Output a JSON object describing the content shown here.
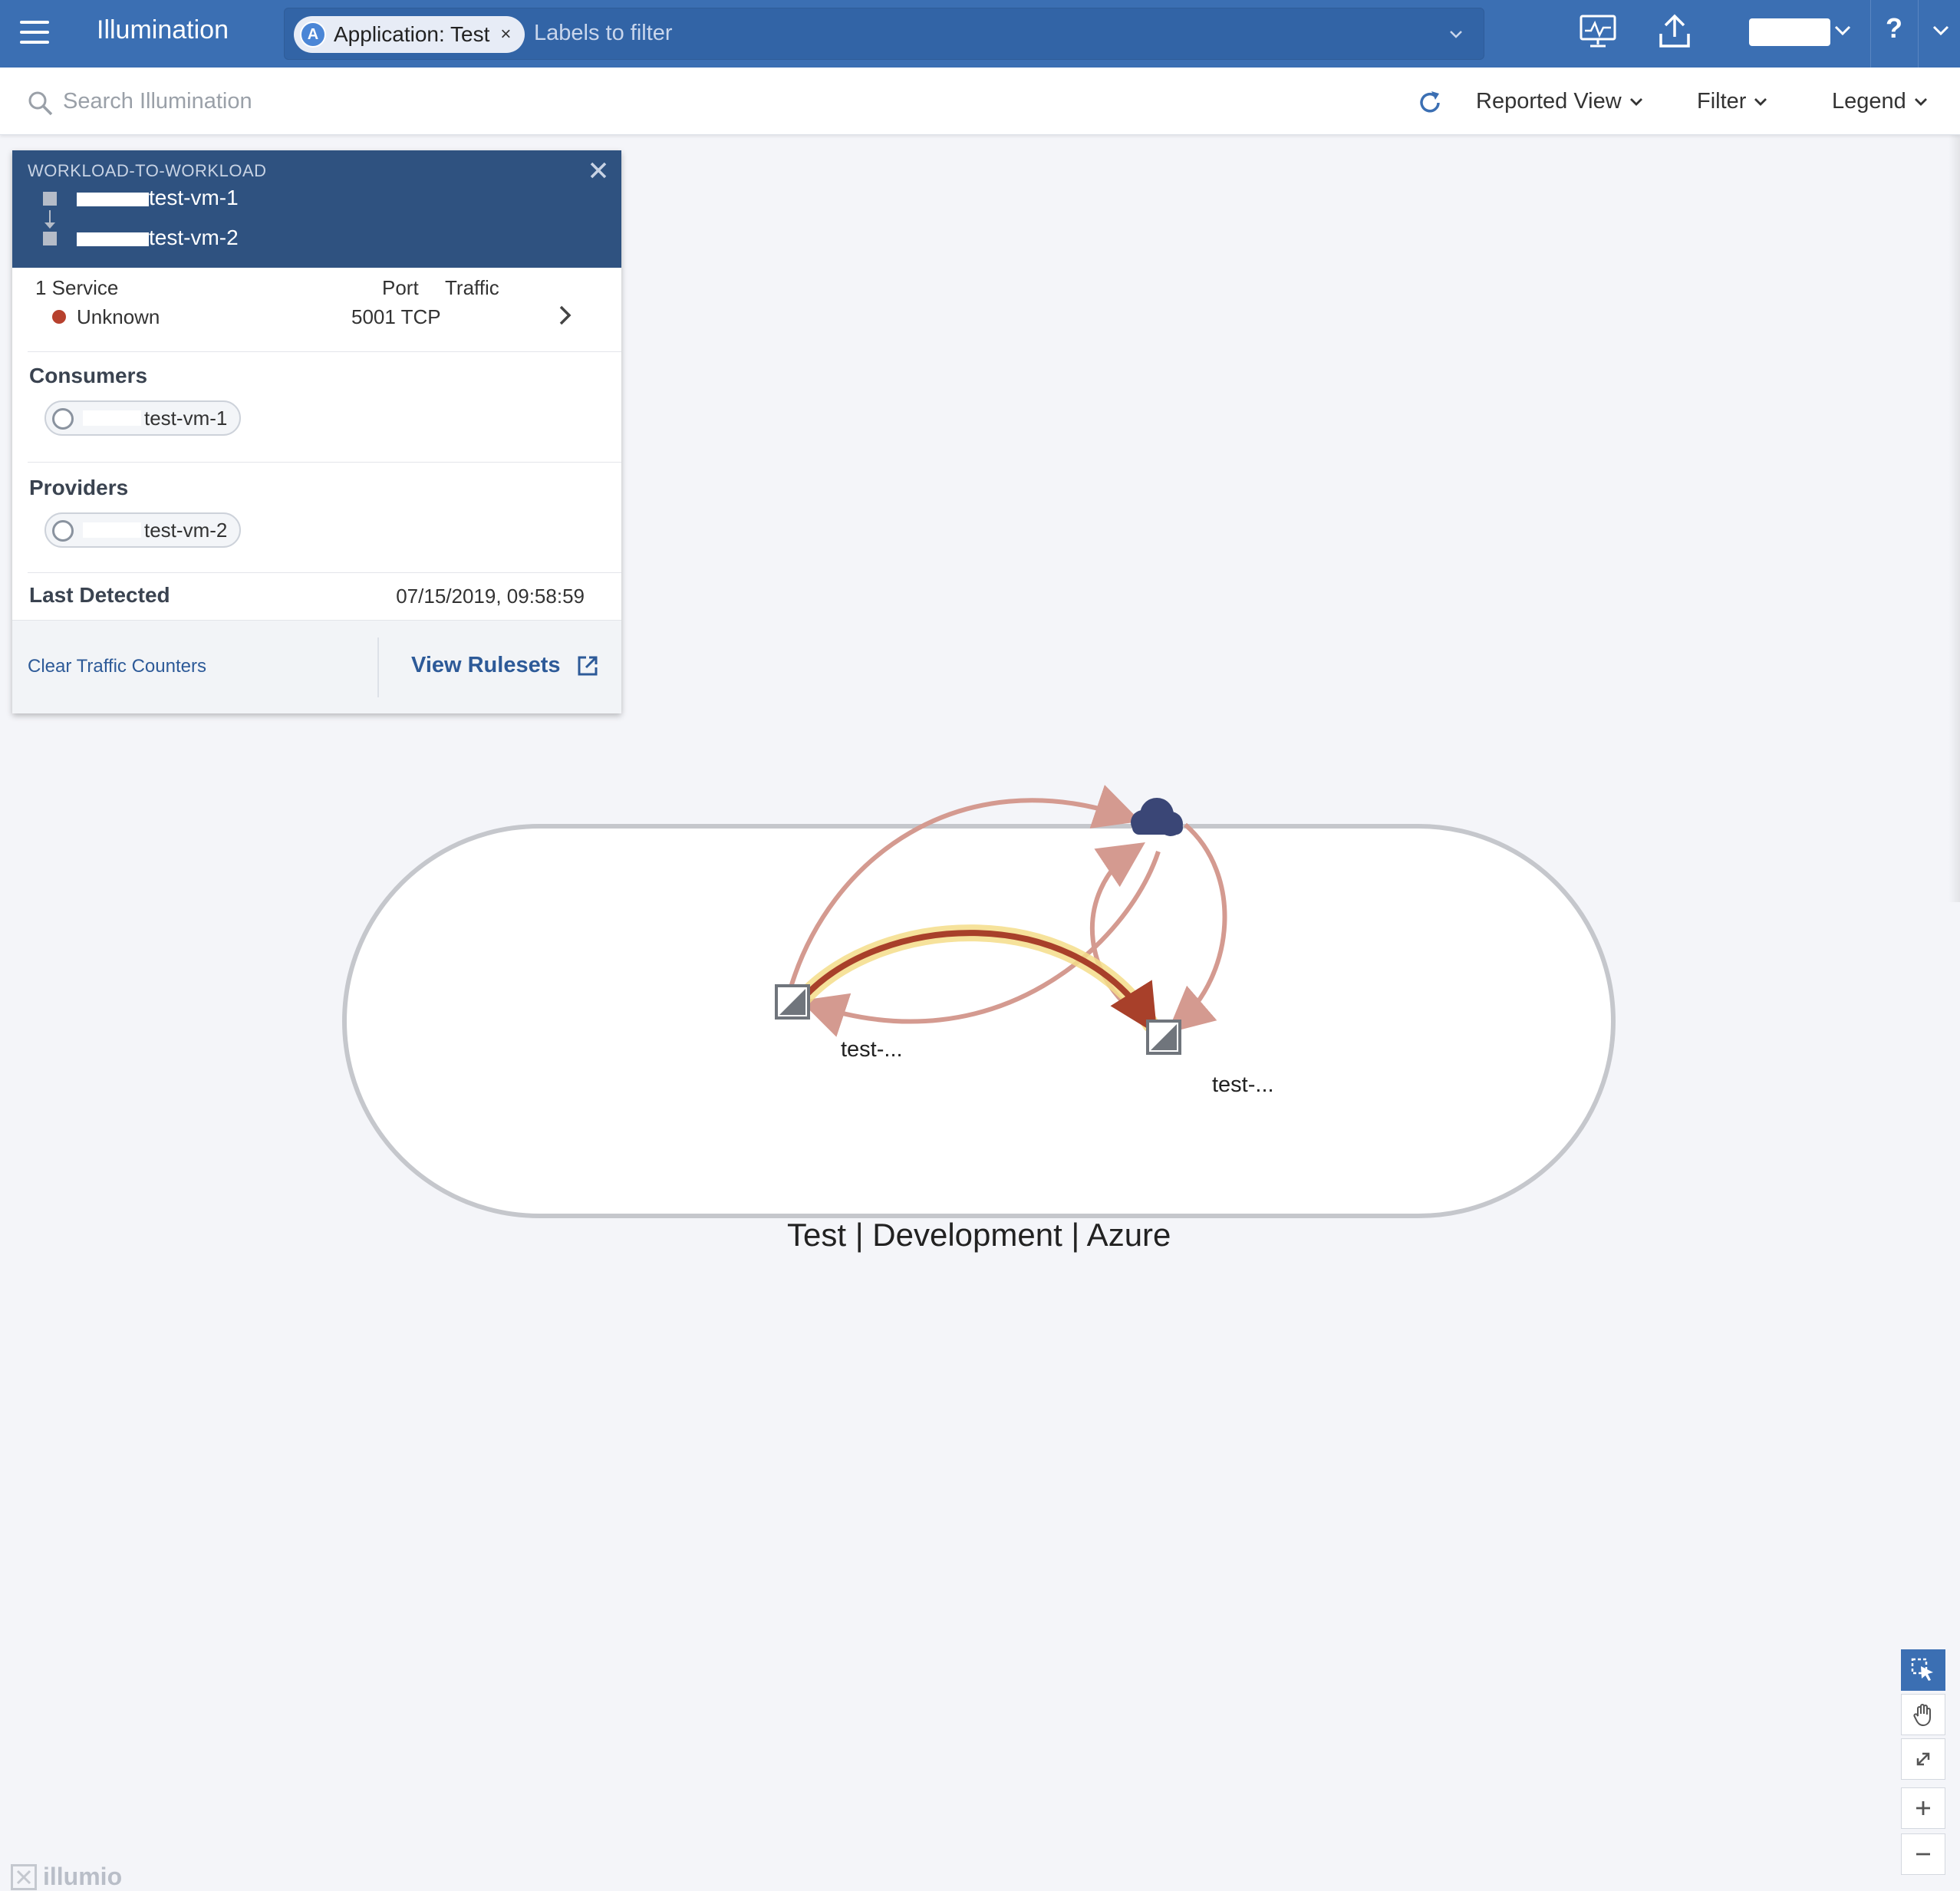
{
  "nav": {
    "app_title": "Illumination",
    "filter_chip": "Application: Test",
    "filter_chip_icon": "A",
    "filter_chip_remove": "×",
    "filter_placeholder": "Labels to filter",
    "help": "?"
  },
  "toolbar": {
    "search_placeholder": "Search Illumination",
    "view_dropdown": "Reported View",
    "filter_dropdown": "Filter",
    "legend_dropdown": "Legend"
  },
  "panel": {
    "kicker": "WORKLOAD-TO-WORKLOAD",
    "source_workload": "test-vm-1",
    "dest_workload": "test-vm-2",
    "services_header": "1 Service",
    "port_header": "Port",
    "traffic_header": "Traffic",
    "service_name": "Unknown",
    "service_port": "5001 TCP",
    "consumers_title": "Consumers",
    "consumer_name": "test-vm-1",
    "providers_title": "Providers",
    "provider_name": "test-vm-2",
    "last_detected_label": "Last Detected",
    "last_detected_value": "07/15/2019, 09:58:59",
    "clear_link": "Clear Traffic Counters",
    "view_rulesets": "View Rulesets"
  },
  "map": {
    "group_label": "Test | Development | Azure",
    "node_1_label": "test-...",
    "node_2_label": "test-..."
  },
  "footer": {
    "brand": "illumio"
  },
  "colors": {
    "nav_bg": "#3b6fb3",
    "panel_head_bg": "#2f5280",
    "link": "#2d5a98",
    "traffic_flow": "#d49a90",
    "selected_flow": "#a8402a",
    "selected_glow": "#f5dd8a",
    "unknown_service_dot": "#b7412e",
    "internet_cloud": "#3a4676"
  }
}
